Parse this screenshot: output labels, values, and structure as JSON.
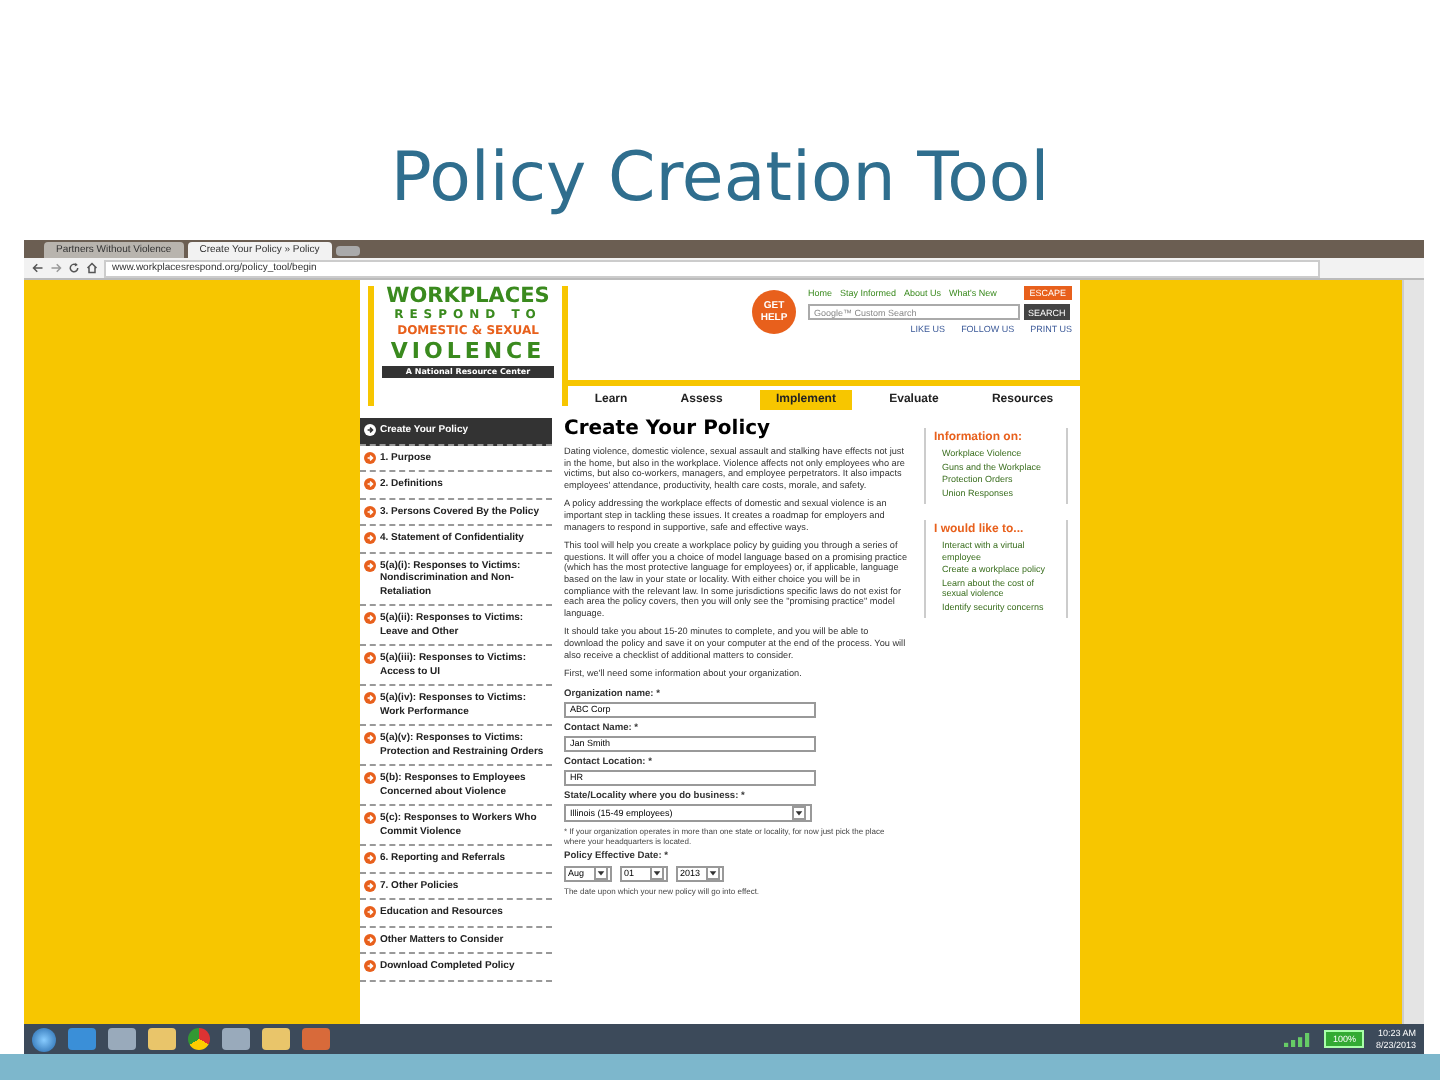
{
  "slide": {
    "title": "Policy Creation Tool"
  },
  "browser": {
    "tabs": [
      {
        "label": "Partners Without Violence",
        "selected": false
      },
      {
        "label": "Create Your Policy » Policy",
        "selected": true
      }
    ],
    "url": "www.workplacesrespond.org/policy_tool/begin"
  },
  "site": {
    "logo": {
      "line1": "WORKPLACES",
      "line2": "RESPOND TO",
      "line3": "DOMESTIC & SEXUAL",
      "line4": "VIOLENCE",
      "tagline": "A National Resource Center"
    },
    "get_help": "GET HELP",
    "top_links": [
      "Home",
      "Stay Informed",
      "About Us",
      "What's New"
    ],
    "escape": "ESCAPE",
    "search": {
      "placeholder": "Google™ Custom Search",
      "button": "SEARCH"
    },
    "social": [
      "LIKE US",
      "FOLLOW US",
      "PRINT US"
    ],
    "nav": [
      {
        "label": "Learn",
        "selected": false
      },
      {
        "label": "Assess",
        "selected": false
      },
      {
        "label": "Implement",
        "selected": true
      },
      {
        "label": "Evaluate",
        "selected": false
      },
      {
        "label": "Resources",
        "selected": false
      }
    ]
  },
  "sidebar": {
    "items": [
      {
        "label": "Create Your Policy",
        "selected": true
      },
      {
        "label": "1. Purpose",
        "selected": false
      },
      {
        "label": "2. Definitions",
        "selected": false
      },
      {
        "label": "3. Persons Covered By the Policy",
        "selected": false
      },
      {
        "label": "4. Statement of Confidentiality",
        "selected": false
      },
      {
        "label": "5(a)(i): Responses to Victims: Nondiscrimination and Non-Retaliation",
        "selected": false
      },
      {
        "label": "5(a)(ii): Responses to Victims: Leave and Other",
        "selected": false
      },
      {
        "label": "5(a)(iii): Responses to Victims: Access to UI",
        "selected": false
      },
      {
        "label": "5(a)(iv): Responses to Victims: Work Performance",
        "selected": false
      },
      {
        "label": "5(a)(v): Responses to Victims: Protection and Restraining Orders",
        "selected": false
      },
      {
        "label": "5(b): Responses to Employees Concerned about Violence",
        "selected": false
      },
      {
        "label": "5(c): Responses to Workers Who Commit Violence",
        "selected": false
      },
      {
        "label": "6. Reporting and Referrals",
        "selected": false
      },
      {
        "label": "7. Other Policies",
        "selected": false
      },
      {
        "label": "Education and Resources",
        "selected": false
      },
      {
        "label": "Other Matters to Consider",
        "selected": false
      },
      {
        "label": "Download Completed Policy",
        "selected": false
      }
    ]
  },
  "main": {
    "title": "Create Your Policy",
    "paragraphs": [
      "Dating violence, domestic violence, sexual assault and stalking have effects not just in the home, but also in the workplace. Violence affects not only employees who are victims, but also co-workers, managers, and employee perpetrators. It also impacts employees' attendance, productivity, health care costs, morale, and safety.",
      "A policy addressing the workplace effects of domestic and sexual violence is an important step in tackling these issues. It creates a roadmap for employers and managers to respond in supportive, safe and effective ways.",
      "This tool will help you create a workplace policy by guiding you through a series of questions. It will offer you a choice of model language based on a promising practice (which has the most protective language for employees) or, if applicable, language based on the law in your state or locality. With either choice you will be in compliance with the relevant law. In some jurisdictions specific laws do not exist for each area the policy covers, then you will only see the \"promising practice\" model language.",
      "It should take you about 15-20 minutes to complete, and you will be able to download the policy and save it on your computer at the end of the process. You will also receive a checklist of additional matters to consider.",
      "First, we'll need some information about your organization."
    ],
    "fields": [
      {
        "label": "Organization name: *",
        "value": "ABC Corp",
        "kind": "text"
      },
      {
        "label": "Contact Name: *",
        "value": "Jan Smith",
        "kind": "text"
      },
      {
        "label": "Contact Location: *",
        "value": "HR",
        "kind": "text"
      },
      {
        "label": "State/Locality where you do business: *",
        "value": "Illinois (15-49 employees)",
        "kind": "select"
      }
    ],
    "note": "* If your organization operates in more than one state or locality, for now just pick the place where your headquarters is located.",
    "date": {
      "label": "Policy Effective Date: *",
      "parts": [
        "Aug",
        "01",
        "2013"
      ],
      "hint": "The date upon which your new policy will go into effect."
    }
  },
  "info_boxes": [
    {
      "title": "Information on:",
      "items": [
        "Workplace Violence",
        "Guns and the Workplace",
        "Protection Orders",
        "Union Responses"
      ]
    },
    {
      "title": "I would like to...",
      "items": [
        "Interact with a virtual employee",
        "Create a workplace policy",
        "Learn about the cost of sexual violence",
        "Identify security concerns"
      ]
    }
  ],
  "taskbar": {
    "battery": "100%",
    "time": "10:23 AM",
    "date": "8/23/2013"
  }
}
